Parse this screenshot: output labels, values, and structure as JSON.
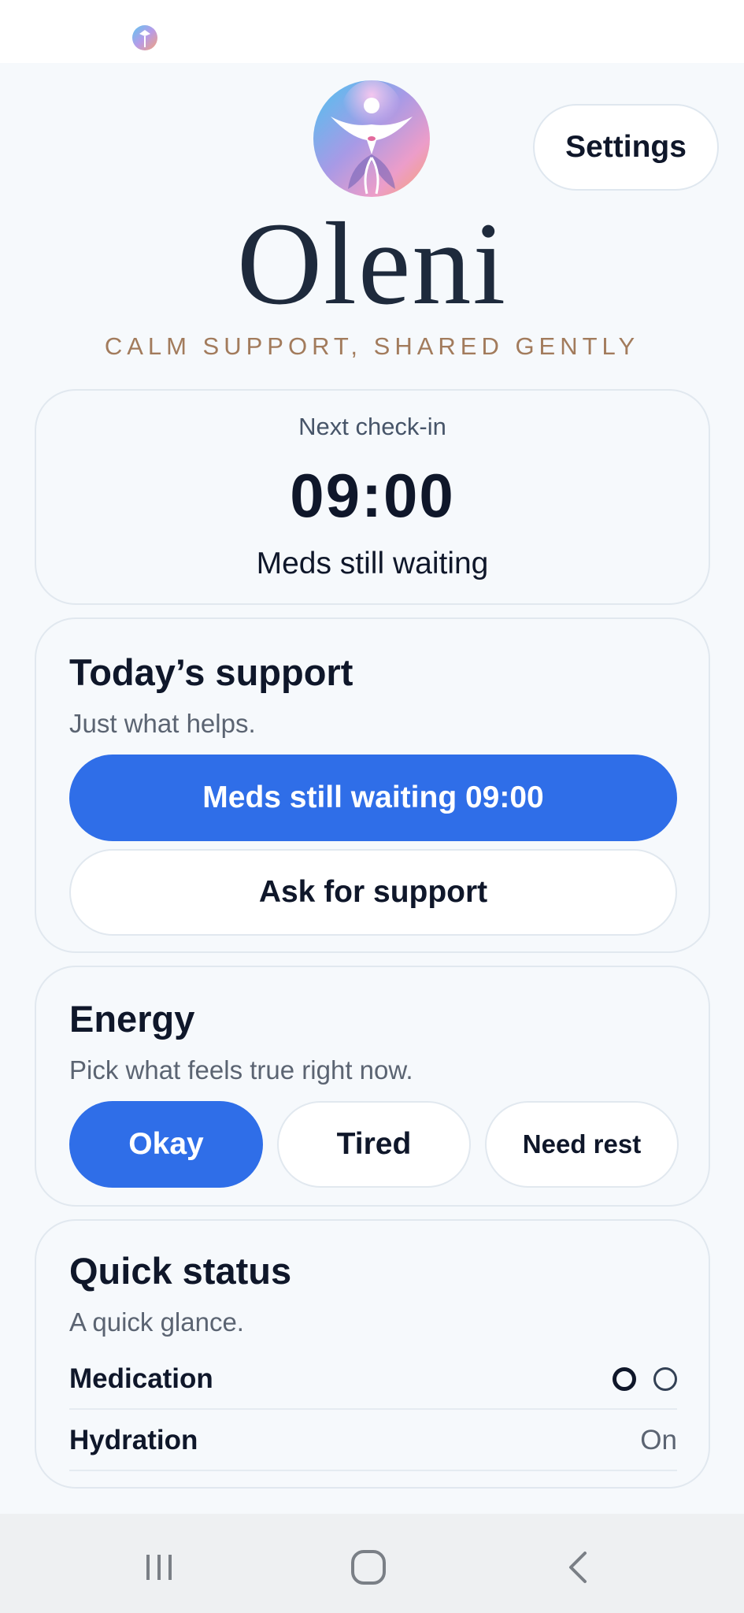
{
  "app": {
    "name": "Oleni",
    "tagline": "CALM SUPPORT, SHARED GENTLY",
    "settings_label": "Settings"
  },
  "checkin": {
    "label": "Next check-in",
    "time": "09:00",
    "status": "Meds still waiting"
  },
  "support": {
    "title": "Today’s support",
    "hint": "Just what helps.",
    "primary_button": "Meds still waiting 09:00",
    "secondary_button": "Ask for support"
  },
  "energy": {
    "title": "Energy",
    "hint": "Pick what feels true right now.",
    "options": [
      "Okay",
      "Tired",
      "Need rest"
    ],
    "selected": "Okay"
  },
  "quick_status": {
    "title": "Quick status",
    "hint": "A quick glance.",
    "rows": [
      {
        "label": "Medication",
        "dots": [
          true,
          false
        ]
      },
      {
        "label": "Hydration",
        "value": "On"
      }
    ]
  },
  "colors": {
    "accent": "#2f6ee8",
    "tagline": "#a27b5c",
    "text": "#0f172a"
  },
  "icons": {
    "logo": "lotus-figure-logo-icon",
    "nav": [
      "recent-apps-icon",
      "home-icon",
      "back-icon"
    ]
  }
}
